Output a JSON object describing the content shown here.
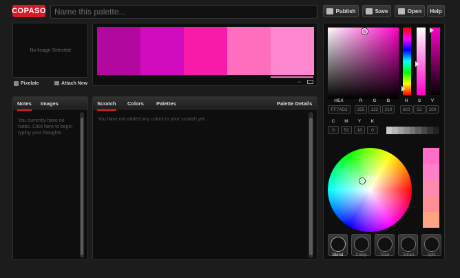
{
  "app": {
    "logo": "COPASO",
    "palette_name_placeholder": "Name this palette..."
  },
  "toolbar": {
    "publish": "Publish",
    "save": "Save",
    "open": "Open",
    "help": "Help"
  },
  "image_panel": {
    "empty_text": "No Image Selected",
    "pixelate": "Pixelate",
    "attach_new": "Attach New"
  },
  "palette": {
    "colors": [
      "#b3089f",
      "#d10cc0",
      "#f71aab",
      "#ff6fbd",
      "#ff87d0"
    ]
  },
  "notes_panel": {
    "tabs": [
      "Notes",
      "Images"
    ],
    "empty_text": "You currently have no notes. Click here to begin typing your thoughts."
  },
  "scratch_panel": {
    "tabs": [
      "Scratch",
      "Colors",
      "Palettes"
    ],
    "details": "Palette Details",
    "empty_text": "You have not added any colors to your scratch yet."
  },
  "picker": {
    "labels": {
      "hex": "HEX",
      "r": "R",
      "g": "G",
      "b": "B",
      "h": "H",
      "s": "S",
      "v": "V",
      "c": "C",
      "m": "M",
      "y": "Y",
      "k": "K"
    },
    "values": {
      "hex": "FF7AD2",
      "r": "255",
      "g": "122",
      "b": "210",
      "h": "320",
      "s": "52",
      "v": "100",
      "c": "0",
      "m": "52",
      "y": "18",
      "k": "0"
    },
    "base_color": "#ff00c6",
    "gray_swatches": [
      "#c8c8c8",
      "#b4b4b4",
      "#a0a0a0",
      "#8a8a8a",
      "#747474",
      "#5e5e5e",
      "#484848",
      "#333333",
      "#222222"
    ]
  },
  "harmony": {
    "swatches": [
      "#ff6fc8",
      "#ff7fc8",
      "#ff8ab0",
      "#ff8f96",
      "#ffa286"
    ],
    "buttons": [
      "Blend",
      "Comp",
      "Triad",
      "Tetrad",
      "Split"
    ],
    "selected": "Blend"
  }
}
